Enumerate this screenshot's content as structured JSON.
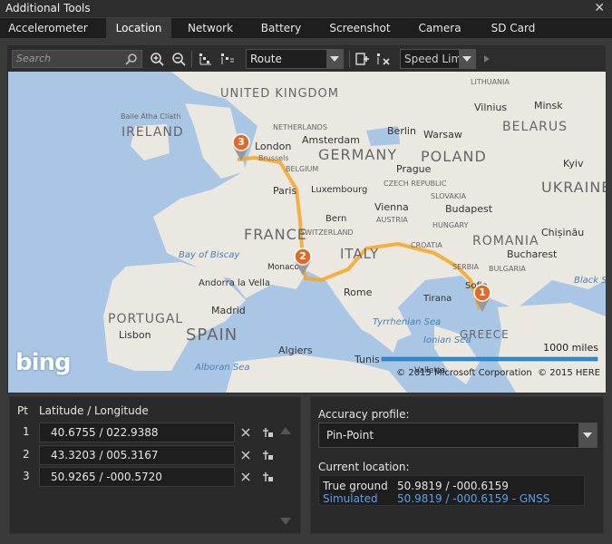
{
  "window": {
    "title": "Additional Tools",
    "close_glyph": "✕"
  },
  "tabs": [
    {
      "label": "Accelerometer",
      "active": false
    },
    {
      "label": "Location",
      "active": true
    },
    {
      "label": "Network",
      "active": false
    },
    {
      "label": "Battery",
      "active": false
    },
    {
      "label": "Screenshot",
      "active": false
    },
    {
      "label": "Camera",
      "active": false
    },
    {
      "label": "SD Card",
      "active": false
    }
  ],
  "toolbar": {
    "search_placeholder": "Search",
    "route_mode": "Route",
    "speed_mode": "Speed Limit",
    "icons": [
      "search-icon",
      "zoom-in-icon",
      "zoom-out-icon",
      "pin-mode-icon",
      "live-mode-icon",
      "add-pin-icon",
      "clear-pins-icon",
      "play-icon"
    ]
  },
  "map": {
    "brand": "bing",
    "copyright": "© 2015 Microsoft Corporation  © 2015 HERE",
    "scale_label": "1000 miles",
    "countries": [
      "UNITED KINGDOM",
      "IRELAND",
      "GERMANY",
      "POLAND",
      "BELARUS",
      "UKRAINE",
      "FRANCE",
      "ITALY",
      "ROMANIA",
      "SPAIN",
      "PORTUGAL",
      "GREECE",
      "LITHUANIA"
    ],
    "cities": [
      "London",
      "Amsterdam",
      "Berlin",
      "Warsaw",
      "Minsk",
      "Vilnius",
      "Brussels",
      "Paris",
      "Luxembourg",
      "Prague",
      "Vienna",
      "Budapest",
      "Kyiv",
      "Chișinău",
      "Bucharest",
      "Sofia",
      "Bern",
      "Monaco",
      "Rome",
      "Tirana",
      "Madrid",
      "Lisbon",
      "Algiers",
      "Tunis",
      "Andorra la Vella",
      "Valletta"
    ],
    "small_labels": [
      "Baile Átha Cliath",
      "NETHERLANDS",
      "BELGIUM",
      "CZECH REPUBLIC",
      "SLOVAKIA",
      "AUSTRIA",
      "HUNGARY",
      "CROATIA",
      "SERBIA",
      "BULGARIA",
      "SWITZERLAND"
    ],
    "seas": [
      "Bay of Biscay",
      "Tyrrhenian Sea",
      "Ionian Sea",
      "Alboran Sea",
      "Black Sea"
    ],
    "pins": [
      {
        "n": "1"
      },
      {
        "n": "2"
      },
      {
        "n": "3"
      }
    ],
    "accent_color": "#f5a623",
    "pin_color": "#e06a2c"
  },
  "points": {
    "header_pt": "Pt",
    "header_latlon": "Latitude / Longitude",
    "rows": [
      {
        "pt": "1",
        "value": "40.6755 / 022.9388"
      },
      {
        "pt": "2",
        "value": "43.3203 / 005.3167"
      },
      {
        "pt": "3",
        "value": "50.9265 / -000.5720"
      }
    ]
  },
  "accuracy": {
    "label": "Accuracy profile:",
    "value": "Pin-Point"
  },
  "current": {
    "label": "Current location:",
    "true_label": "True ground",
    "true_value": "50.9819 / -000.6159",
    "sim_label": "Simulated",
    "sim_value": "50.9819 / -000.6159 - GNSS",
    "sim_color": "#5aa0ea"
  }
}
